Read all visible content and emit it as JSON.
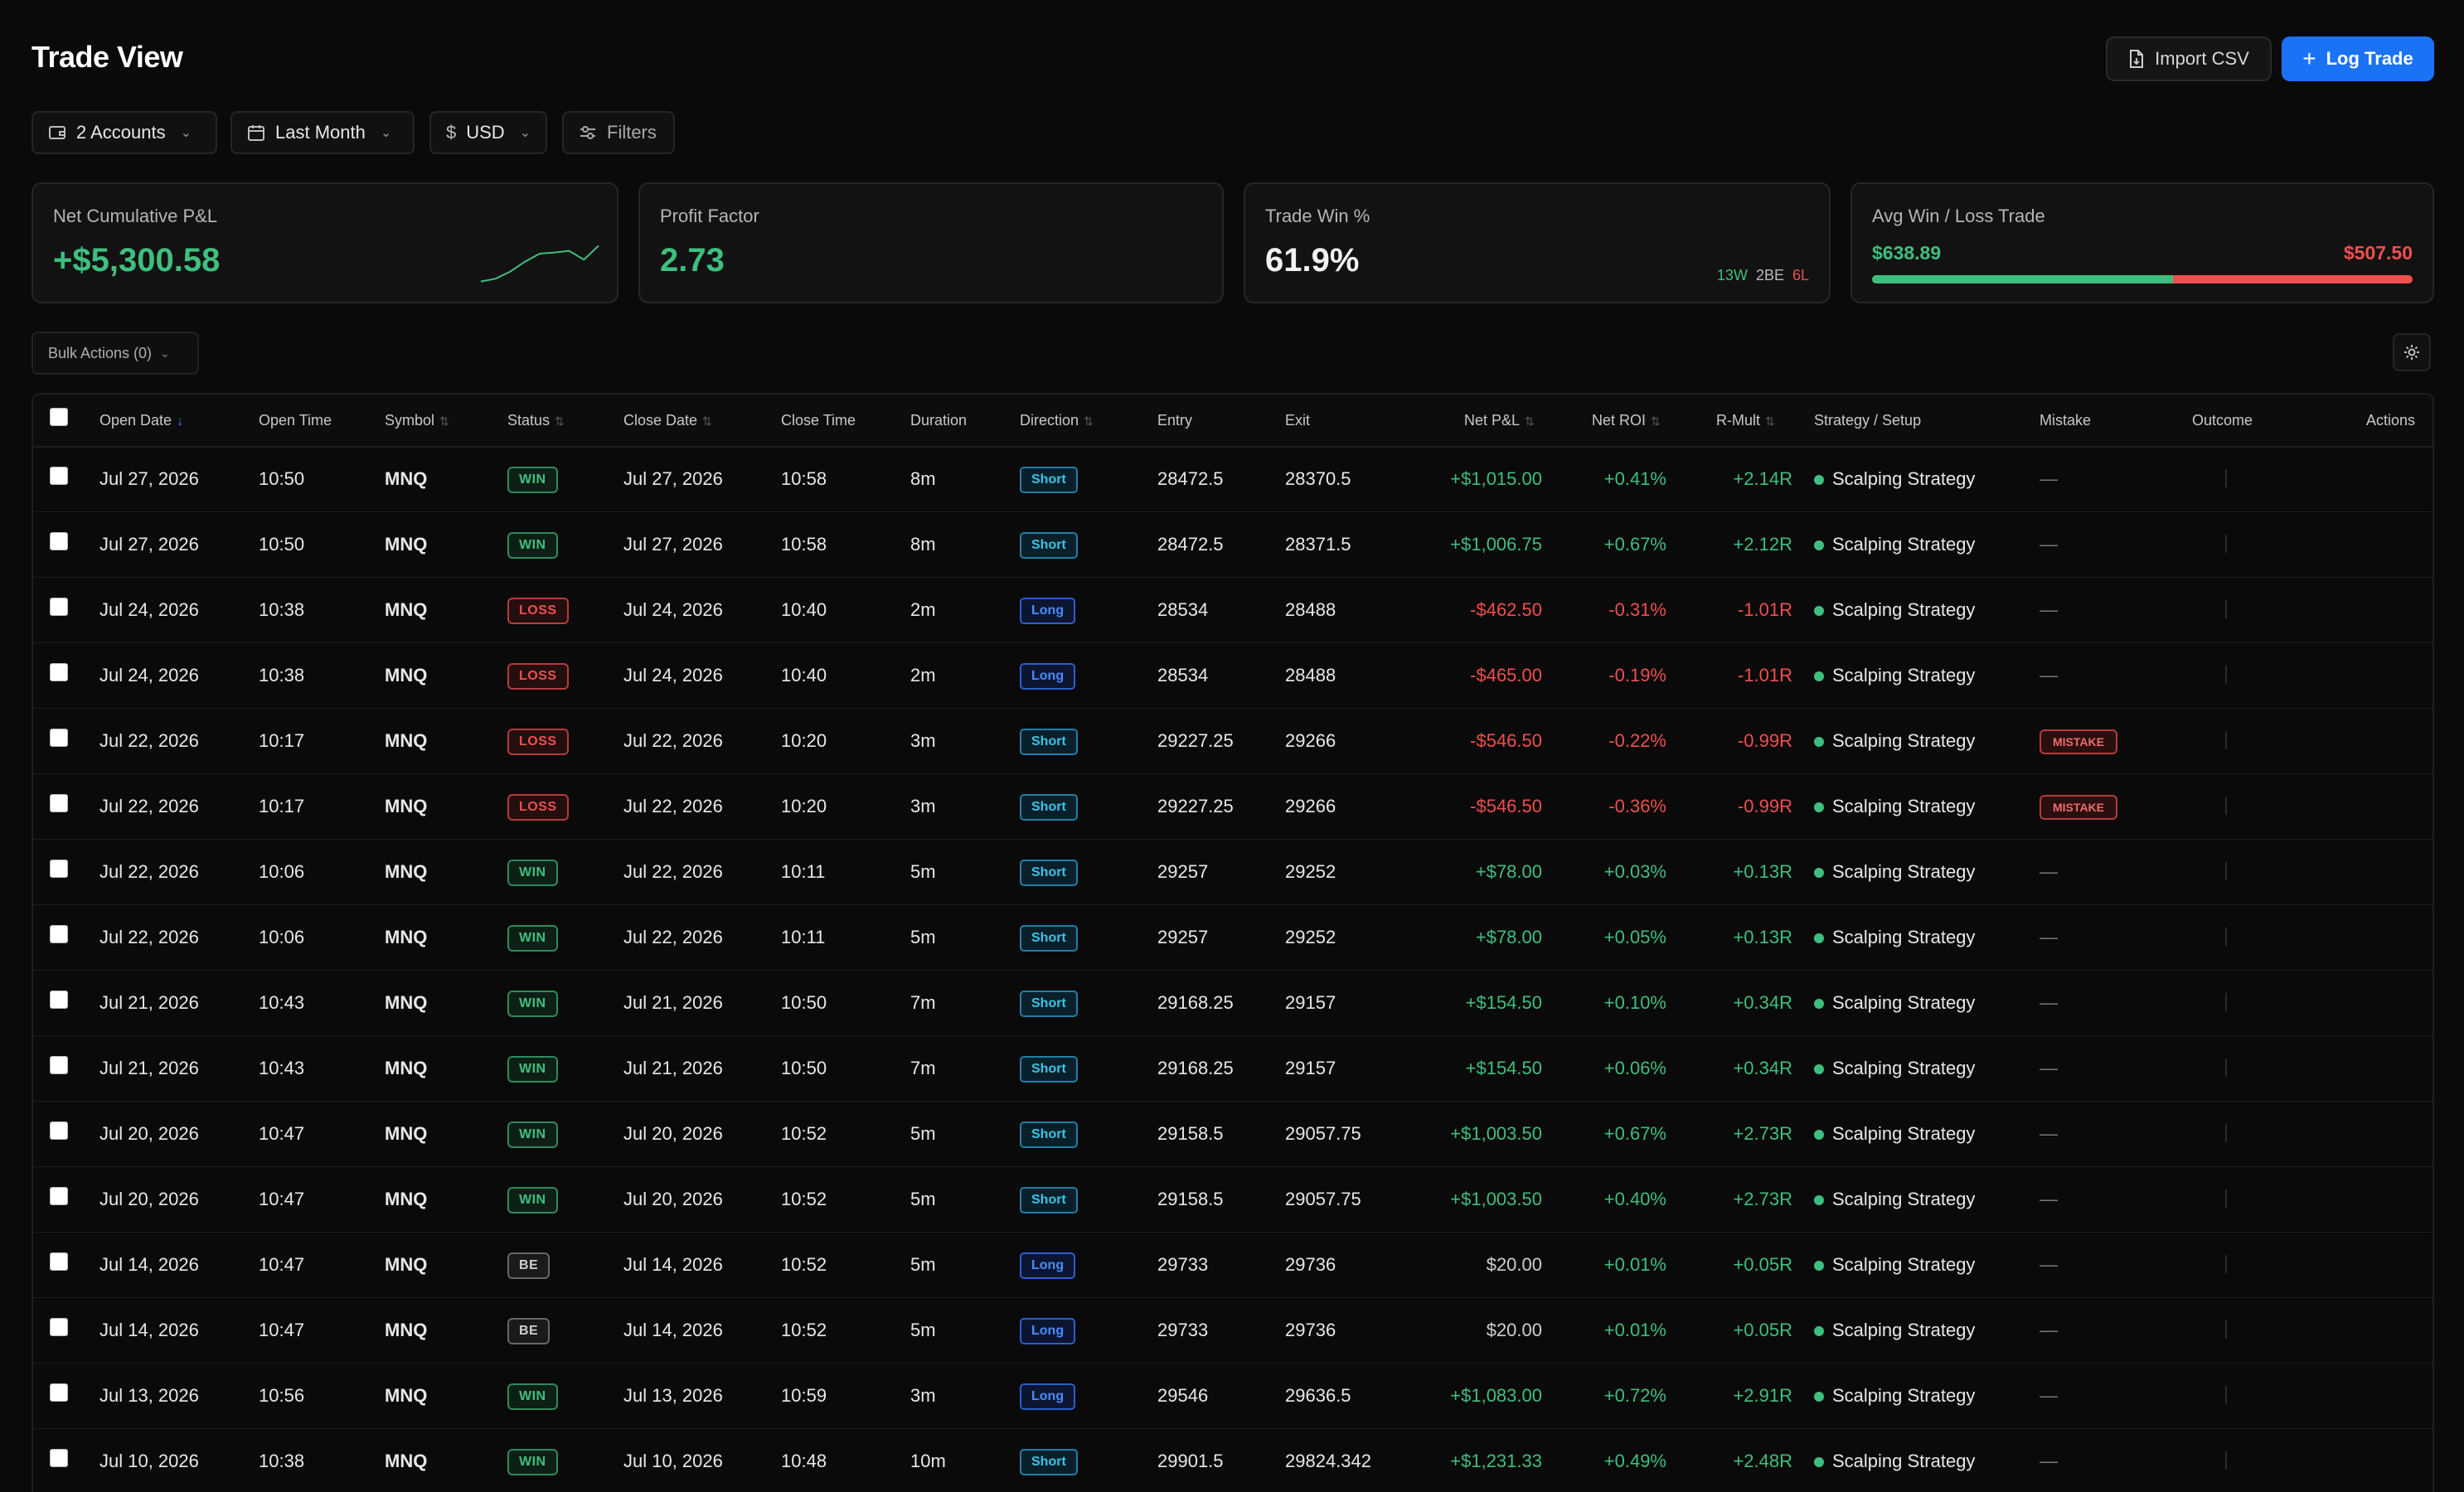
{
  "header": {
    "title": "Trade View",
    "import_label": "Import CSV",
    "log_label": "Log Trade",
    "accent": "#1a73f5"
  },
  "filters": {
    "accounts": "2 Accounts",
    "period": "Last Month",
    "currency_symbol": "$",
    "currency": "USD",
    "filters_label": "Filters"
  },
  "stats": {
    "net_pnl_label": "Net Cumulative P&L",
    "net_pnl_value": "+$5,300.58",
    "net_pnl_sparkline": [
      0.05,
      0.12,
      0.3,
      0.55,
      0.75,
      0.78,
      0.82,
      0.6,
      0.95
    ],
    "profit_factor_label": "Profit Factor",
    "profit_factor_value": "2.73",
    "win_label": "Trade Win %",
    "win_value": "61.9%",
    "wins": "13W",
    "breakeven": "2BE",
    "losses": "6L",
    "avg_label": "Avg Win / Loss Trade",
    "avg_win": "$638.89",
    "avg_loss": "$507.50"
  },
  "toolbar": {
    "bulk_label": "Bulk Actions (0)"
  },
  "table": {
    "headers": {
      "open_date": "Open Date",
      "open_time": "Open Time",
      "symbol": "Symbol",
      "status": "Status",
      "close_date": "Close Date",
      "close_time": "Close Time",
      "duration": "Duration",
      "direction": "Direction",
      "entry": "Entry",
      "exit": "Exit",
      "net_pnl": "Net P&L",
      "net_roi": "Net ROI",
      "r_mult": "R-Mult",
      "strategy": "Strategy / Setup",
      "mistake": "Mistake",
      "outcome": "Outcome",
      "actions": "Actions"
    },
    "rows": [
      {
        "open_date": "Jul 27, 2026",
        "open_time": "10:50",
        "symbol": "MNQ",
        "status": "WIN",
        "close_date": "Jul 27, 2026",
        "close_time": "10:58",
        "duration": "8m",
        "direction": "Short",
        "entry": "28472.5",
        "exit": "28370.5",
        "net_pnl": "+$1,015.00",
        "net_roi": "+0.41%",
        "r_mult": "+2.14R",
        "strategy": "Scalping Strategy",
        "mistake": "—"
      },
      {
        "open_date": "Jul 27, 2026",
        "open_time": "10:50",
        "symbol": "MNQ",
        "status": "WIN",
        "close_date": "Jul 27, 2026",
        "close_time": "10:58",
        "duration": "8m",
        "direction": "Short",
        "entry": "28472.5",
        "exit": "28371.5",
        "net_pnl": "+$1,006.75",
        "net_roi": "+0.67%",
        "r_mult": "+2.12R",
        "strategy": "Scalping Strategy",
        "mistake": "—"
      },
      {
        "open_date": "Jul 24, 2026",
        "open_time": "10:38",
        "symbol": "MNQ",
        "status": "LOSS",
        "close_date": "Jul 24, 2026",
        "close_time": "10:40",
        "duration": "2m",
        "direction": "Long",
        "entry": "28534",
        "exit": "28488",
        "net_pnl": "-$462.50",
        "net_roi": "-0.31%",
        "r_mult": "-1.01R",
        "strategy": "Scalping Strategy",
        "mistake": "—"
      },
      {
        "open_date": "Jul 24, 2026",
        "open_time": "10:38",
        "symbol": "MNQ",
        "status": "LOSS",
        "close_date": "Jul 24, 2026",
        "close_time": "10:40",
        "duration": "2m",
        "direction": "Long",
        "entry": "28534",
        "exit": "28488",
        "net_pnl": "-$465.00",
        "net_roi": "-0.19%",
        "r_mult": "-1.01R",
        "strategy": "Scalping Strategy",
        "mistake": "—"
      },
      {
        "open_date": "Jul 22, 2026",
        "open_time": "10:17",
        "symbol": "MNQ",
        "status": "LOSS",
        "close_date": "Jul 22, 2026",
        "close_time": "10:20",
        "duration": "3m",
        "direction": "Short",
        "entry": "29227.25",
        "exit": "29266",
        "net_pnl": "-$546.50",
        "net_roi": "-0.22%",
        "r_mult": "-0.99R",
        "strategy": "Scalping Strategy",
        "mistake": "MISTAKE"
      },
      {
        "open_date": "Jul 22, 2026",
        "open_time": "10:17",
        "symbol": "MNQ",
        "status": "LOSS",
        "close_date": "Jul 22, 2026",
        "close_time": "10:20",
        "duration": "3m",
        "direction": "Short",
        "entry": "29227.25",
        "exit": "29266",
        "net_pnl": "-$546.50",
        "net_roi": "-0.36%",
        "r_mult": "-0.99R",
        "strategy": "Scalping Strategy",
        "mistake": "MISTAKE"
      },
      {
        "open_date": "Jul 22, 2026",
        "open_time": "10:06",
        "symbol": "MNQ",
        "status": "WIN",
        "close_date": "Jul 22, 2026",
        "close_time": "10:11",
        "duration": "5m",
        "direction": "Short",
        "entry": "29257",
        "exit": "29252",
        "net_pnl": "+$78.00",
        "net_roi": "+0.03%",
        "r_mult": "+0.13R",
        "strategy": "Scalping Strategy",
        "mistake": "—"
      },
      {
        "open_date": "Jul 22, 2026",
        "open_time": "10:06",
        "symbol": "MNQ",
        "status": "WIN",
        "close_date": "Jul 22, 2026",
        "close_time": "10:11",
        "duration": "5m",
        "direction": "Short",
        "entry": "29257",
        "exit": "29252",
        "net_pnl": "+$78.00",
        "net_roi": "+0.05%",
        "r_mult": "+0.13R",
        "strategy": "Scalping Strategy",
        "mistake": "—"
      },
      {
        "open_date": "Jul 21, 2026",
        "open_time": "10:43",
        "symbol": "MNQ",
        "status": "WIN",
        "close_date": "Jul 21, 2026",
        "close_time": "10:50",
        "duration": "7m",
        "direction": "Short",
        "entry": "29168.25",
        "exit": "29157",
        "net_pnl": "+$154.50",
        "net_roi": "+0.10%",
        "r_mult": "+0.34R",
        "strategy": "Scalping Strategy",
        "mistake": "—"
      },
      {
        "open_date": "Jul 21, 2026",
        "open_time": "10:43",
        "symbol": "MNQ",
        "status": "WIN",
        "close_date": "Jul 21, 2026",
        "close_time": "10:50",
        "duration": "7m",
        "direction": "Short",
        "entry": "29168.25",
        "exit": "29157",
        "net_pnl": "+$154.50",
        "net_roi": "+0.06%",
        "r_mult": "+0.34R",
        "strategy": "Scalping Strategy",
        "mistake": "—"
      },
      {
        "open_date": "Jul 20, 2026",
        "open_time": "10:47",
        "symbol": "MNQ",
        "status": "WIN",
        "close_date": "Jul 20, 2026",
        "close_time": "10:52",
        "duration": "5m",
        "direction": "Short",
        "entry": "29158.5",
        "exit": "29057.75",
        "net_pnl": "+$1,003.50",
        "net_roi": "+0.67%",
        "r_mult": "+2.73R",
        "strategy": "Scalping Strategy",
        "mistake": "—"
      },
      {
        "open_date": "Jul 20, 2026",
        "open_time": "10:47",
        "symbol": "MNQ",
        "status": "WIN",
        "close_date": "Jul 20, 2026",
        "close_time": "10:52",
        "duration": "5m",
        "direction": "Short",
        "entry": "29158.5",
        "exit": "29057.75",
        "net_pnl": "+$1,003.50",
        "net_roi": "+0.40%",
        "r_mult": "+2.73R",
        "strategy": "Scalping Strategy",
        "mistake": "—"
      },
      {
        "open_date": "Jul 14, 2026",
        "open_time": "10:47",
        "symbol": "MNQ",
        "status": "BE",
        "close_date": "Jul 14, 2026",
        "close_time": "10:52",
        "duration": "5m",
        "direction": "Long",
        "entry": "29733",
        "exit": "29736",
        "net_pnl": "$20.00",
        "net_roi": "+0.01%",
        "r_mult": "+0.05R",
        "strategy": "Scalping Strategy",
        "mistake": "—"
      },
      {
        "open_date": "Jul 14, 2026",
        "open_time": "10:47",
        "symbol": "MNQ",
        "status": "BE",
        "close_date": "Jul 14, 2026",
        "close_time": "10:52",
        "duration": "5m",
        "direction": "Long",
        "entry": "29733",
        "exit": "29736",
        "net_pnl": "$20.00",
        "net_roi": "+0.01%",
        "r_mult": "+0.05R",
        "strategy": "Scalping Strategy",
        "mistake": "—"
      },
      {
        "open_date": "Jul 13, 2026",
        "open_time": "10:56",
        "symbol": "MNQ",
        "status": "WIN",
        "close_date": "Jul 13, 2026",
        "close_time": "10:59",
        "duration": "3m",
        "direction": "Long",
        "entry": "29546",
        "exit": "29636.5",
        "net_pnl": "+$1,083.00",
        "net_roi": "+0.72%",
        "r_mult": "+2.91R",
        "strategy": "Scalping Strategy",
        "mistake": "—"
      },
      {
        "open_date": "Jul 10, 2026",
        "open_time": "10:38",
        "symbol": "MNQ",
        "status": "WIN",
        "close_date": "Jul 10, 2026",
        "close_time": "10:48",
        "duration": "10m",
        "direction": "Short",
        "entry": "29901.5",
        "exit": "29824.342",
        "net_pnl": "+$1,231.33",
        "net_roi": "+0.49%",
        "r_mult": "+2.48R",
        "strategy": "Scalping Strategy",
        "mistake": "—"
      }
    ]
  },
  "colors": {
    "win": "#3fbf7f",
    "loss": "#ef4f4f",
    "short": "#38c6e8",
    "long": "#4a8cff"
  }
}
